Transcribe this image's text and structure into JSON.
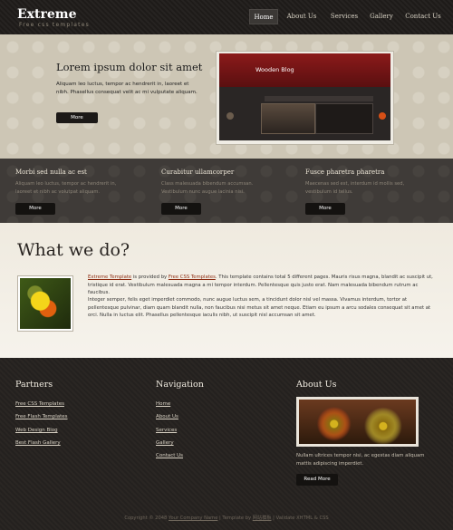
{
  "header": {
    "logo": "Extreme",
    "tagline": "Free css templates",
    "nav": [
      "Home",
      "About Us",
      "Services",
      "Gallery",
      "Contact Us"
    ]
  },
  "hero": {
    "title": "Lorem ipsum dolor sit amet",
    "text": "Aliquam leo luctus, tempor ac hendrerit in, laoreet et nibh. Phasellus consequat velit ac mi vulputate aliquam.",
    "button": "More",
    "screenshot_title": "Wooden Blog"
  },
  "features": [
    {
      "title": "Morbi sed nulla ac est",
      "text": "Aliquam leo luctus, tempor ac hendrerit in, laoreet et nibh ac volutpat aliquam.",
      "button": "More"
    },
    {
      "title": "Curabitur ullamcorper",
      "text": "Class malesuada bibendum accumsan. Vestibulum nunc augue lacinia nisi.",
      "button": "More"
    },
    {
      "title": "Fusce pharetra pharetra",
      "text": "Maecenas sed est, interdum id mollis sed, vestibulum id tellus.",
      "button": "More"
    }
  ],
  "main": {
    "heading": "What we do?",
    "para1_link1": "Extreme Template",
    "para1_mid": " is provided by ",
    "para1_link2": "Free CSS Templates",
    "para1_rest": ". This template contains total 5 different pages. Mauris risus magna, blandit ac suscipit ut, tristique id erat. Vestibulum malesuada magna a mi tempor interdum. Pellentesque quis justo erat. Nam malesuada bibendum rutrum ac faucibus.",
    "para2": "Integer semper, felis eget imperdiet commodo, nunc augue luctus sem, a tincidunt dolor nisl vel massa. Vivamus interdum, tortor at pellentesque pulvinar, diam quam blandit nulla, non faucibus nisi metus sit amet neque. Etiam eu ipsum a arcu sodales consequat sit amet at orci. Nulla in luctus elit. Phasellus pellentesque iaculis nibh, ut suscipit nisl accumsan sit amet."
  },
  "footer": {
    "partners_title": "Partners",
    "partners": [
      "Free CSS Templates",
      "Free Flash Templates",
      "Web Design Blog",
      "Best Flash Gallery"
    ],
    "navigation_title": "Navigation",
    "navigation": [
      "Home",
      "About Us",
      "Services",
      "Gallery",
      "Contact Us"
    ],
    "about_title": "About Us",
    "about_text": "Nullam ultrices tempor nisi, ac egestas diam aliquam mattis adipiscing imperdiet.",
    "about_button": "Read More",
    "copyright_prefix": "Copyright © 2048",
    "company": "Your Company Name",
    "sep1": " | Template by ",
    "template_by": "网站模板",
    "sep2": " | Validate XHTML & CSS"
  }
}
